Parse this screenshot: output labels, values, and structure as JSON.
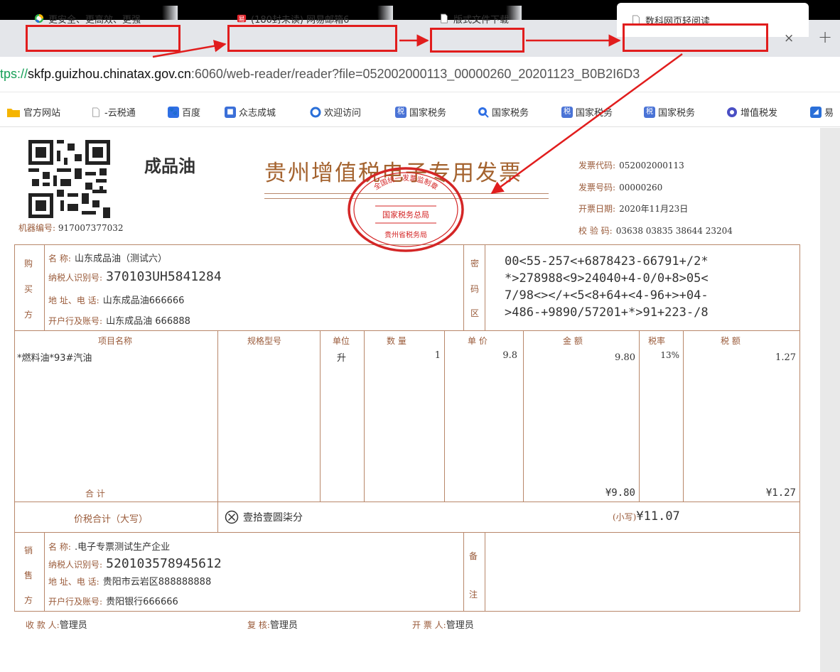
{
  "browser": {
    "tabs": [
      {
        "title": "更安全、更高效、更强"
      },
      {
        "title": "(180封未读) 网易邮箱6"
      },
      {
        "title": "版式文件下载"
      },
      {
        "title": "数科网页轻阅读"
      }
    ],
    "close_symbol": "×",
    "new_tab_symbol": "+",
    "url": {
      "protocol": "tps://",
      "domain": "skfp.guizhou.chinatax.gov.cn",
      "rest": ":6060/web-reader/reader?file=052002000113_00000260_20201123_B0B2I6D3"
    },
    "bookmarks": [
      {
        "label": "官方网站",
        "icon": "folder-icon",
        "color": "#f5b400"
      },
      {
        "label": "-云税通",
        "icon": "page-icon",
        "color": "#cccccc"
      },
      {
        "label": "百度",
        "icon": "paw-icon",
        "color": "#2f6fe4"
      },
      {
        "label": "众志成城",
        "icon": "square-icon",
        "color": "#3b6fd8"
      },
      {
        "label": "欢迎访问",
        "icon": "ring-icon",
        "color": "#2a6fd8"
      },
      {
        "label": "国家税务",
        "icon": "tax-icon",
        "color": "#4a73d6"
      },
      {
        "label": "国家税务",
        "icon": "search-icon",
        "color": "#2f6fe4"
      },
      {
        "label": "国家税务",
        "icon": "tax-icon",
        "color": "#4a73d6"
      },
      {
        "label": "国家税务",
        "icon": "tax-icon",
        "color": "#4a73d6"
      },
      {
        "label": "增值税发",
        "icon": "circle-icon",
        "color": "#4a4fc4"
      },
      {
        "label": "易",
        "icon": "app-icon",
        "color": "#2a6fd8"
      }
    ]
  },
  "invoice": {
    "product_title": "成品油",
    "title": "贵州增值税电子专用发票",
    "machine_no_label": "机器编号:",
    "machine_no": "917007377032",
    "meta": [
      {
        "label": "发票代码:",
        "value": "052002000113"
      },
      {
        "label": "发票号码:",
        "value": "00000260"
      },
      {
        "label": "开票日期:",
        "value": "2020年11月23日"
      },
      {
        "label": "校 验 码:",
        "value": "03638 03835 38644 23204"
      }
    ],
    "buyer": {
      "side_label": [
        "购",
        "买",
        "方"
      ],
      "fields": [
        {
          "label": "名      称:",
          "value": "山东成品油（测试六）"
        },
        {
          "label": "纳税人识别号:",
          "value": "370103UH5841284"
        },
        {
          "label": "地 址、电 话:",
          "value": "山东成品油666666"
        },
        {
          "label": "开户行及账号:",
          "value": "山东成品油 666888"
        }
      ]
    },
    "cipher_label": [
      "密",
      "码",
      "区"
    ],
    "cipher_lines": [
      "00<55-257<+6878423-66791+/2*",
      "*>278988<9>24040+4-0/0+8>05<",
      "7/98<></+<5<8+64+<4-96+>+04-",
      ">486-+9890/57201+*>91+223-/8"
    ],
    "columns": [
      "项目名称",
      "规格型号",
      "单位",
      "数 量",
      "单 价",
      "金 额",
      "税率",
      "税 额"
    ],
    "item": {
      "name": "*燃料油*93#汽油",
      "spec": "",
      "unit": "升",
      "qty": "1",
      "price": "9.8",
      "amount": "9.80",
      "rate": "13%",
      "tax": "1.27"
    },
    "total_label": "合      计",
    "total_amount": "¥9.80",
    "total_tax": "¥1.27",
    "grand_total_label": "价税合计（大写）",
    "grand_total_words": "壹拾壹圆柒分",
    "grand_total_small_label": "(小写)",
    "grand_total_small": "¥11.07",
    "seller": {
      "side_label": [
        "销",
        "售",
        "方"
      ],
      "fields": [
        {
          "label": "名      称:",
          "value": ".电子专票测试生产企业"
        },
        {
          "label": "纳税人识别号:",
          "value": "520103578945612"
        },
        {
          "label": "地 址、电 话:",
          "value": "贵阳市云岩区888888888"
        },
        {
          "label": "开户行及账号:",
          "value": "贵阳银行666666"
        }
      ]
    },
    "remark_label": [
      "备",
      "注"
    ],
    "footer": [
      {
        "label": "收 款 人:",
        "value": "管理员"
      },
      {
        "label": "复   核:",
        "value": "管理员"
      },
      {
        "label": "开 票 人:",
        "value": "管理员"
      }
    ],
    "stamp": {
      "top": "全国统一发票监制章",
      "middle": "国家税务总局",
      "bottom": "贵州省税务局"
    }
  }
}
